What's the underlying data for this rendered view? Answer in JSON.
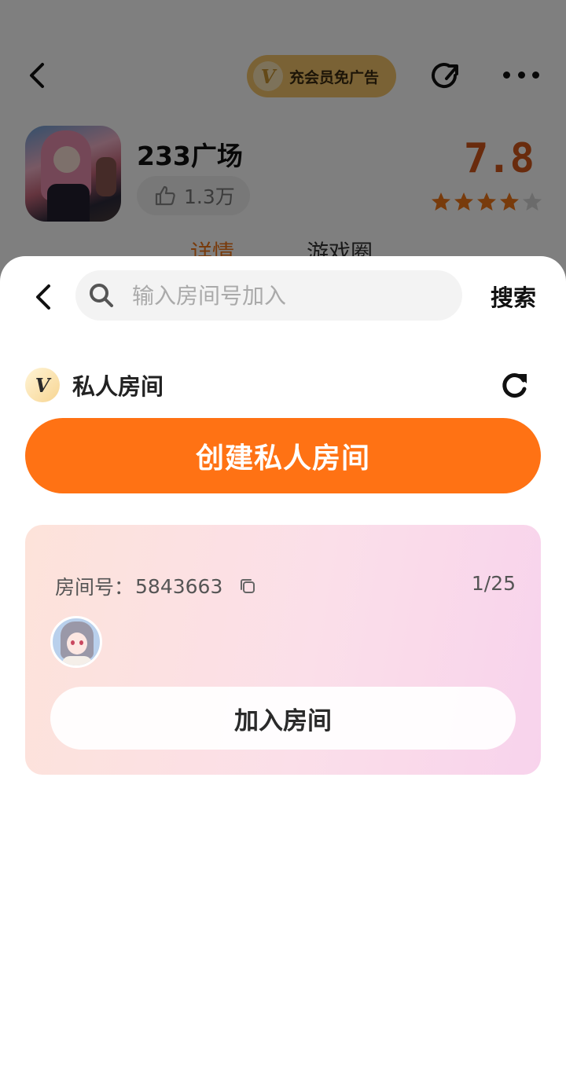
{
  "background_page": {
    "vip_banner": {
      "badge": "V",
      "label": "充会员免广告"
    },
    "app": {
      "name": "233广场",
      "likes": "1.3万",
      "rating": "7.8",
      "stars": 4
    },
    "tabs": [
      {
        "label": "详情"
      },
      {
        "label": "游戏圈"
      }
    ],
    "icons": [
      "back-icon",
      "share-icon",
      "more-icon",
      "thumb-up-icon",
      "star-icon"
    ]
  },
  "sheet": {
    "search": {
      "placeholder": "输入房间号加入",
      "value": "",
      "button_label": "搜索"
    },
    "section": {
      "badge": "V",
      "title": "私人房间"
    },
    "create_button_label": "创建私人房间",
    "rooms": [
      {
        "id_label": "房间号：",
        "id_value": "5843663",
        "occupancy": "1/25",
        "join_label": "加入房间"
      }
    ]
  },
  "colors": {
    "accent_orange": "#ff7214",
    "tab_active": "#f07619",
    "rating": "#d2561a",
    "vip_gold": "#f4c56a",
    "card_gradient_start": "#fde3da",
    "card_gradient_end": "#f8d3ec"
  }
}
